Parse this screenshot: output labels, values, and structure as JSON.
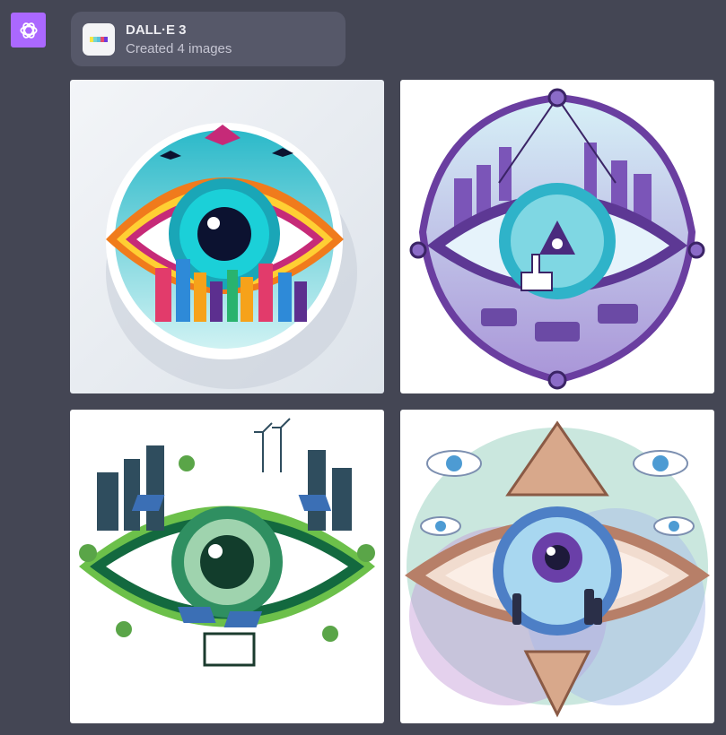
{
  "assistant": {
    "avatar_icon": "openai-logo-icon",
    "avatar_color": "#ab68ff"
  },
  "plugin": {
    "title": "DALL·E 3",
    "status": "Created 4 images",
    "icon": "dalle-logo-icon",
    "logo_colors": [
      "#f7e544",
      "#74d6d2",
      "#5bc0de",
      "#e64b6c",
      "#6d3bdb"
    ]
  },
  "images": [
    {
      "icon": "eye-city-sticker-image"
    },
    {
      "icon": "purple-eye-city-image"
    },
    {
      "icon": "green-eye-solar-city-image"
    },
    {
      "icon": "watercolor-eye-pyramid-image"
    }
  ],
  "colors": {
    "background": "#444654",
    "chip": "#565869"
  }
}
